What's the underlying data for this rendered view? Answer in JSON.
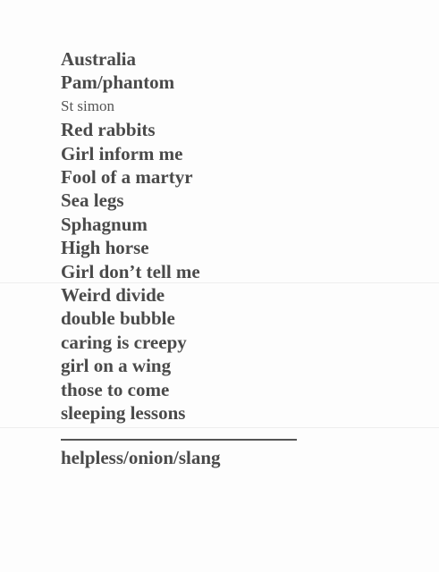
{
  "setlist": {
    "songs": [
      "Australia",
      "Pam/phantom",
      "St simon",
      "Red rabbits",
      "Girl inform me",
      "Fool of a martyr",
      "Sea legs",
      "Sphagnum",
      "High horse",
      "Girl don’t tell me",
      "Weird divide",
      "double bubble",
      "caring is creepy",
      "girl on a wing",
      "those to come",
      "sleeping lessons"
    ],
    "encore": "helpless/onion/slang"
  }
}
